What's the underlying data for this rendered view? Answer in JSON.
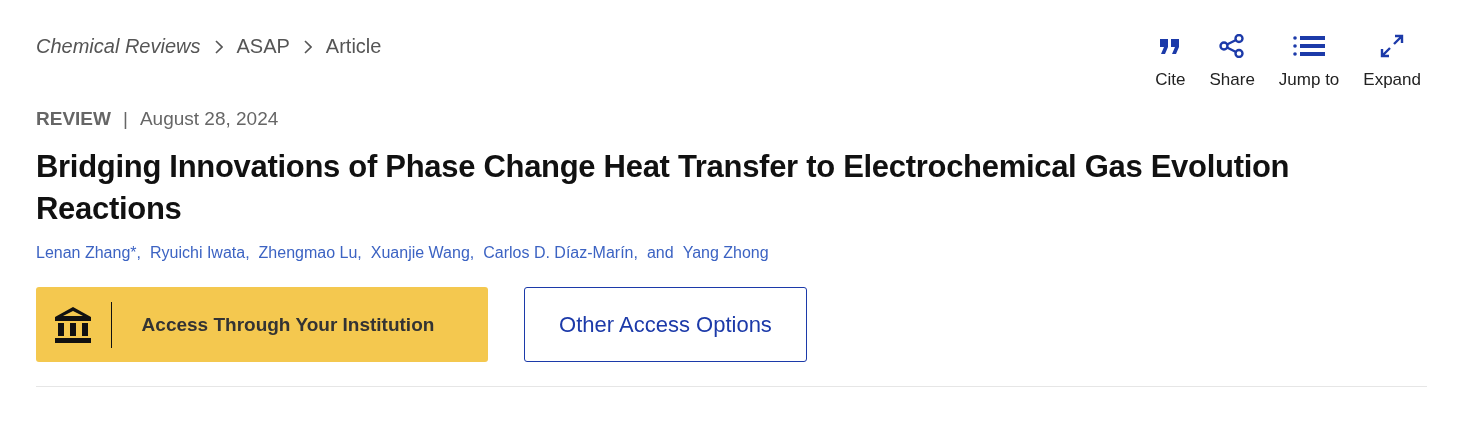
{
  "breadcrumb": [
    {
      "label": "Chemical Reviews",
      "kind": "journal"
    },
    {
      "label": "ASAP",
      "kind": "plain"
    },
    {
      "label": "Article",
      "kind": "plain"
    }
  ],
  "toolbar": [
    {
      "label": "Cite",
      "kind": "cite"
    },
    {
      "label": "Share",
      "kind": "share"
    },
    {
      "label": "Jump to",
      "kind": "list"
    },
    {
      "label": "Expand",
      "kind": "expand"
    }
  ],
  "article_type": "REVIEW",
  "separator": "|",
  "date": "August 28, 2024",
  "title": "Bridging Innovations of Phase Change Heat Transfer to Electrochemical Gas Evolution Reactions",
  "authors": [
    "Lenan Zhang*,",
    "Ryuichi Iwata,",
    "Zhengmao Lu,",
    "Xuanjie Wang,",
    "Carlos D. Díaz-Marín,"
  ],
  "authors_conjunction": "and",
  "last_author": "Yang Zhong",
  "access_buttons": [
    {
      "label": "Access Through Your Institution",
      "kind": "institution"
    },
    {
      "label": "Other Access Options",
      "kind": "outline"
    }
  ]
}
